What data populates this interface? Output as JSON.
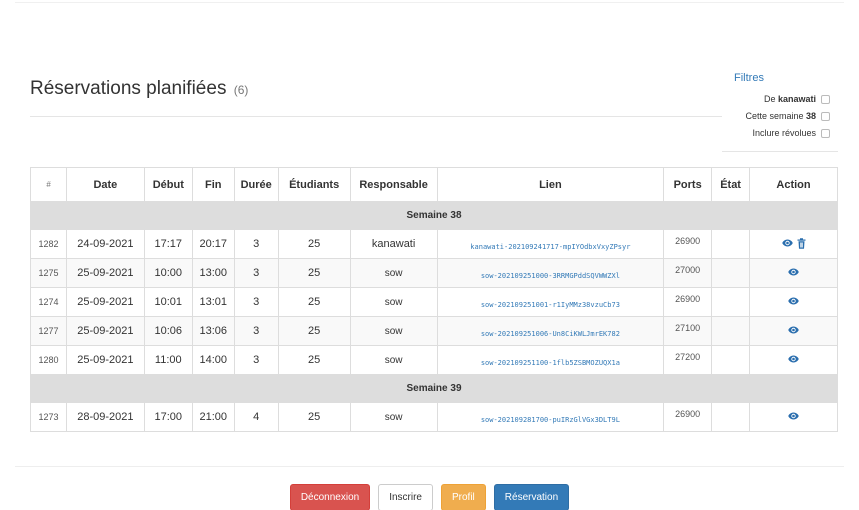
{
  "header": {
    "title": "Réservations planifiées",
    "count": "(6)"
  },
  "filters": {
    "title": "Filtres",
    "items": [
      {
        "prefix": "De ",
        "bold": "kanawati",
        "checked": false
      },
      {
        "prefix": "Cette semaine ",
        "bold": "38",
        "checked": false
      },
      {
        "prefix": "Inclure révolues",
        "bold": "",
        "checked": false
      }
    ]
  },
  "table": {
    "columns": [
      "#",
      "Date",
      "Début",
      "Fin",
      "Durée",
      "Étudiants",
      "Responsable",
      "Lien",
      "Ports",
      "État",
      "Action"
    ],
    "groups": [
      {
        "label": "Semaine 38",
        "rows": [
          {
            "id": "1282",
            "date": "24-09-2021",
            "debut": "17:17",
            "fin": "20:17",
            "duree": "3",
            "etudiants": "25",
            "responsable": "kanawati",
            "lien": "kanawati-202109241717-mpIYOdbxVxyZPsyr",
            "ports": "26900",
            "etat": "",
            "actions": [
              "view",
              "delete"
            ]
          },
          {
            "id": "1275",
            "date": "25-09-2021",
            "debut": "10:00",
            "fin": "13:00",
            "duree": "3",
            "etudiants": "25",
            "responsable": "sow",
            "lien": "sow-202109251000-3RRMGPddSQVWWZXl",
            "ports": "27000",
            "etat": "",
            "actions": [
              "view"
            ]
          },
          {
            "id": "1274",
            "date": "25-09-2021",
            "debut": "10:01",
            "fin": "13:01",
            "duree": "3",
            "etudiants": "25",
            "responsable": "sow",
            "lien": "sow-202109251001-r1IyMMz38vzuCb73",
            "ports": "26900",
            "etat": "",
            "actions": [
              "view"
            ]
          },
          {
            "id": "1277",
            "date": "25-09-2021",
            "debut": "10:06",
            "fin": "13:06",
            "duree": "3",
            "etudiants": "25",
            "responsable": "sow",
            "lien": "sow-202109251006-Un8CiKWLJmrEK782",
            "ports": "27100",
            "etat": "",
            "actions": [
              "view"
            ]
          },
          {
            "id": "1280",
            "date": "25-09-2021",
            "debut": "11:00",
            "fin": "14:00",
            "duree": "3",
            "etudiants": "25",
            "responsable": "sow",
            "lien": "sow-202109251100-1flb5ZSBMOZUQX1a",
            "ports": "27200",
            "etat": "",
            "actions": [
              "view"
            ]
          }
        ]
      },
      {
        "label": "Semaine 39",
        "rows": [
          {
            "id": "1273",
            "date": "28-09-2021",
            "debut": "17:00",
            "fin": "21:00",
            "duree": "4",
            "etudiants": "25",
            "responsable": "sow",
            "lien": "sow-202109281700-puIRzGlVGx3DLT9L",
            "ports": "26900",
            "etat": "",
            "actions": [
              "view"
            ]
          }
        ]
      }
    ]
  },
  "buttons": {
    "logout": "Déconnexion",
    "register": "Inscrire",
    "profile": "Profil",
    "reservation": "Réservation"
  },
  "colors": {
    "link": "#337ab7",
    "danger": "#d9534f",
    "warning": "#f0ad4e",
    "primary": "#337ab7",
    "group_row": "#dddddd"
  },
  "icons": {
    "view": "eye-icon",
    "delete": "trash-icon"
  }
}
